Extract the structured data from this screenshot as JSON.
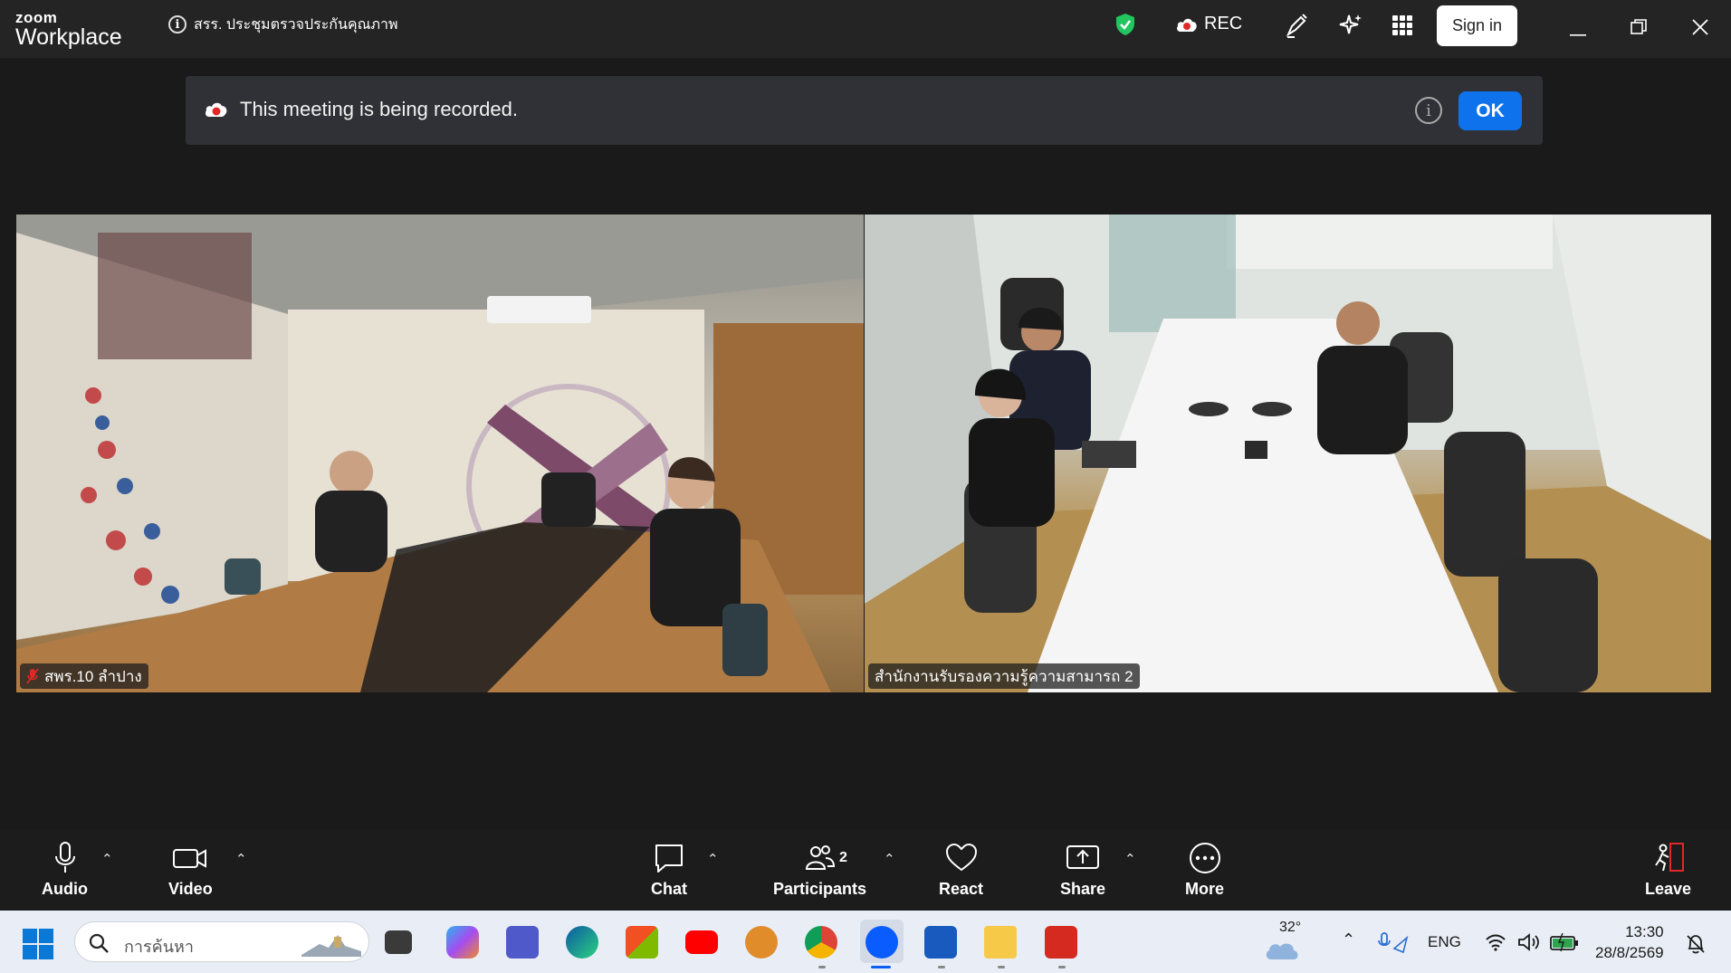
{
  "titlebar": {
    "logo_top": "zoom",
    "logo_bottom": "Workplace",
    "meeting_title": "สรร. ประชุมตรวจประกันคุณภาพ",
    "rec_label": "REC",
    "sign_in": "Sign in",
    "shield_color": "#22c55e",
    "rec_color": "#e02828"
  },
  "banner": {
    "message": "This meeting is being recorded.",
    "ok_label": "OK",
    "info_glyph": "i"
  },
  "participants": [
    {
      "name": "สพร.10 ลำปาง",
      "muted": true
    },
    {
      "name": "สำนักงานรับรองความรู้ความสามารถ 2",
      "muted": false
    }
  ],
  "toolbar": {
    "audio": "Audio",
    "video": "Video",
    "chat": "Chat",
    "participants": "Participants",
    "participants_count": "2",
    "react": "React",
    "share": "Share",
    "more": "More",
    "leave": "Leave",
    "leave_color": "#e02828"
  },
  "taskbar": {
    "search_placeholder": "การค้นหา",
    "weather_temp": "32°",
    "language": "ENG",
    "time": "13:30",
    "date": "28/8/2569"
  }
}
